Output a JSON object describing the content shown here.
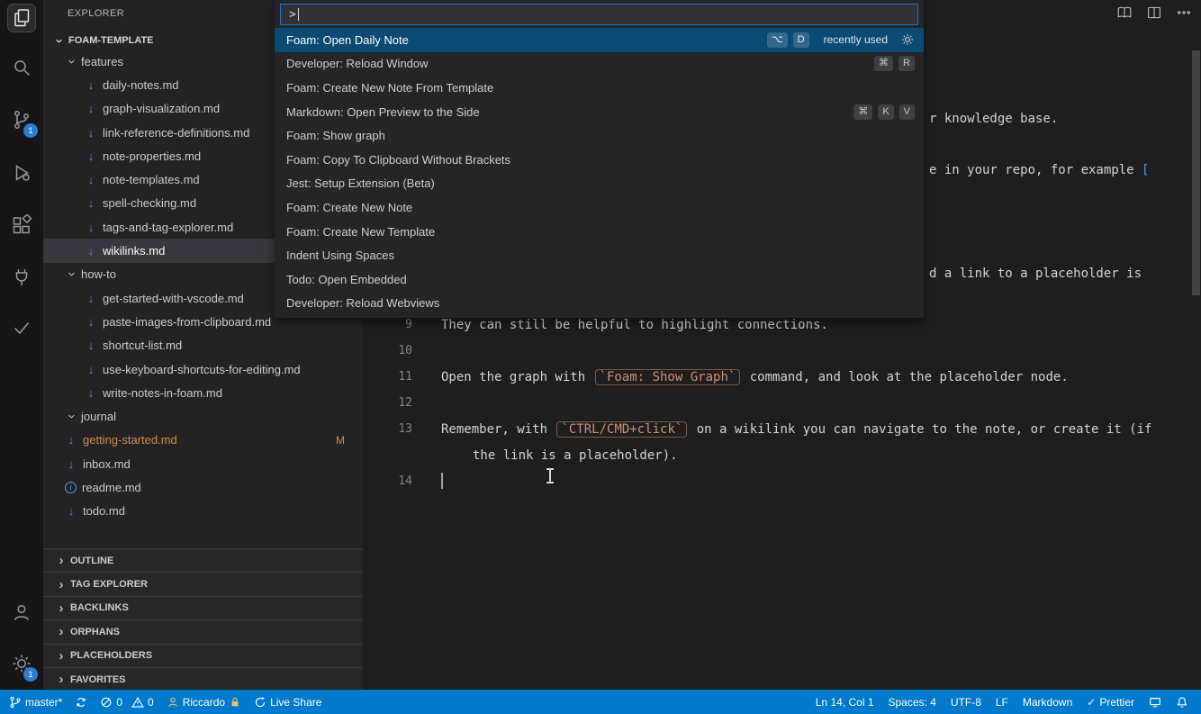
{
  "glyphs": {
    "chevron": "›",
    "md_arrow": "↓",
    "info": "i",
    "check": "✓"
  },
  "activity_bar": {
    "icons": [
      "explorer",
      "search",
      "source-control",
      "run-debug",
      "extensions",
      "remote-plug",
      "testing",
      "account",
      "settings"
    ],
    "source_control_badge": "1",
    "settings_badge": "1"
  },
  "explorer": {
    "title": "EXPLORER",
    "root_label": "FOAM-TEMPLATE",
    "tree": [
      {
        "label": "features",
        "kind": "folder"
      },
      {
        "label": "daily-notes.md",
        "kind": "md"
      },
      {
        "label": "graph-visualization.md",
        "kind": "md"
      },
      {
        "label": "link-reference-definitions.md",
        "kind": "md"
      },
      {
        "label": "note-properties.md",
        "kind": "md"
      },
      {
        "label": "note-templates.md",
        "kind": "md"
      },
      {
        "label": "spell-checking.md",
        "kind": "md"
      },
      {
        "label": "tags-and-tag-explorer.md",
        "kind": "md"
      },
      {
        "label": "wikilinks.md",
        "kind": "md",
        "selected": true
      },
      {
        "label": "how-to",
        "kind": "folder"
      },
      {
        "label": "get-started-with-vscode.md",
        "kind": "md"
      },
      {
        "label": "paste-images-from-clipboard.md",
        "kind": "md"
      },
      {
        "label": "shortcut-list.md",
        "kind": "md"
      },
      {
        "label": "use-keyboard-shortcuts-for-editing.md",
        "kind": "md"
      },
      {
        "label": "write-notes-in-foam.md",
        "kind": "md"
      },
      {
        "label": "journal",
        "kind": "folder"
      },
      {
        "label": "getting-started.md",
        "kind": "md",
        "modified": true,
        "badge": "M"
      },
      {
        "label": "inbox.md",
        "kind": "md"
      },
      {
        "label": "readme.md",
        "kind": "info"
      },
      {
        "label": "todo.md",
        "kind": "md"
      }
    ],
    "panels": [
      {
        "label": "OUTLINE"
      },
      {
        "label": "TAG EXPLORER"
      },
      {
        "label": "BACKLINKS"
      },
      {
        "label": "ORPHANS"
      },
      {
        "label": "PLACEHOLDERS"
      },
      {
        "label": "FAVORITES"
      }
    ]
  },
  "palette": {
    "prompt": ">",
    "items": [
      {
        "label": "Foam: Open Daily Note",
        "keys": [
          "⌥",
          "D"
        ],
        "meta": "recently used",
        "selected": true
      },
      {
        "label": "Developer: Reload Window",
        "keys": [
          "⌘",
          "R"
        ]
      },
      {
        "label": "Foam: Create New Note From Template"
      },
      {
        "label": "Markdown: Open Preview to the Side",
        "keys": [
          "⌘",
          "K",
          "V"
        ]
      },
      {
        "label": "Foam: Show graph"
      },
      {
        "label": "Foam: Copy To Clipboard Without Brackets"
      },
      {
        "label": "Jest: Setup Extension (Beta)"
      },
      {
        "label": "Foam: Create New Note"
      },
      {
        "label": "Foam: Create New Template"
      },
      {
        "label": "Indent Using Spaces"
      },
      {
        "label": "Todo: Open Embedded"
      },
      {
        "label": "Developer: Reload Webviews"
      }
    ]
  },
  "editor": {
    "fragments": [
      {
        "text": "r knowledge base."
      },
      {
        "pre": "e in your repo, for example ",
        "bracket": "["
      },
      {
        "text": "d a link to a placeholder is"
      }
    ],
    "lines": [
      {
        "num": "9",
        "text": "They can still be helpful to highlight connections."
      },
      {
        "num": "10",
        "text": ""
      },
      {
        "num": "11",
        "pre": "Open the graph with ",
        "code": "`Foam: Show Graph`",
        "post": " command, and look at the placeholder node."
      },
      {
        "num": "12",
        "text": ""
      },
      {
        "num": "13",
        "pre": "Remember, with ",
        "code": "`CTRL/CMD+click`",
        "post": " on a wikilink you can navigate to the note, or create it (if"
      },
      {
        "wrap": "the link is a placeholder)."
      },
      {
        "num": "14",
        "text": ""
      }
    ]
  },
  "status_bar": {
    "branch": "master*",
    "errors": "0",
    "warnings": "0",
    "user": "Riccardo",
    "live_share": "Live Share",
    "line_col": "Ln 14, Col 1",
    "spaces": "Spaces: 4",
    "encoding": "UTF-8",
    "eol": "LF",
    "language": "Markdown",
    "formatter": "Prettier"
  }
}
